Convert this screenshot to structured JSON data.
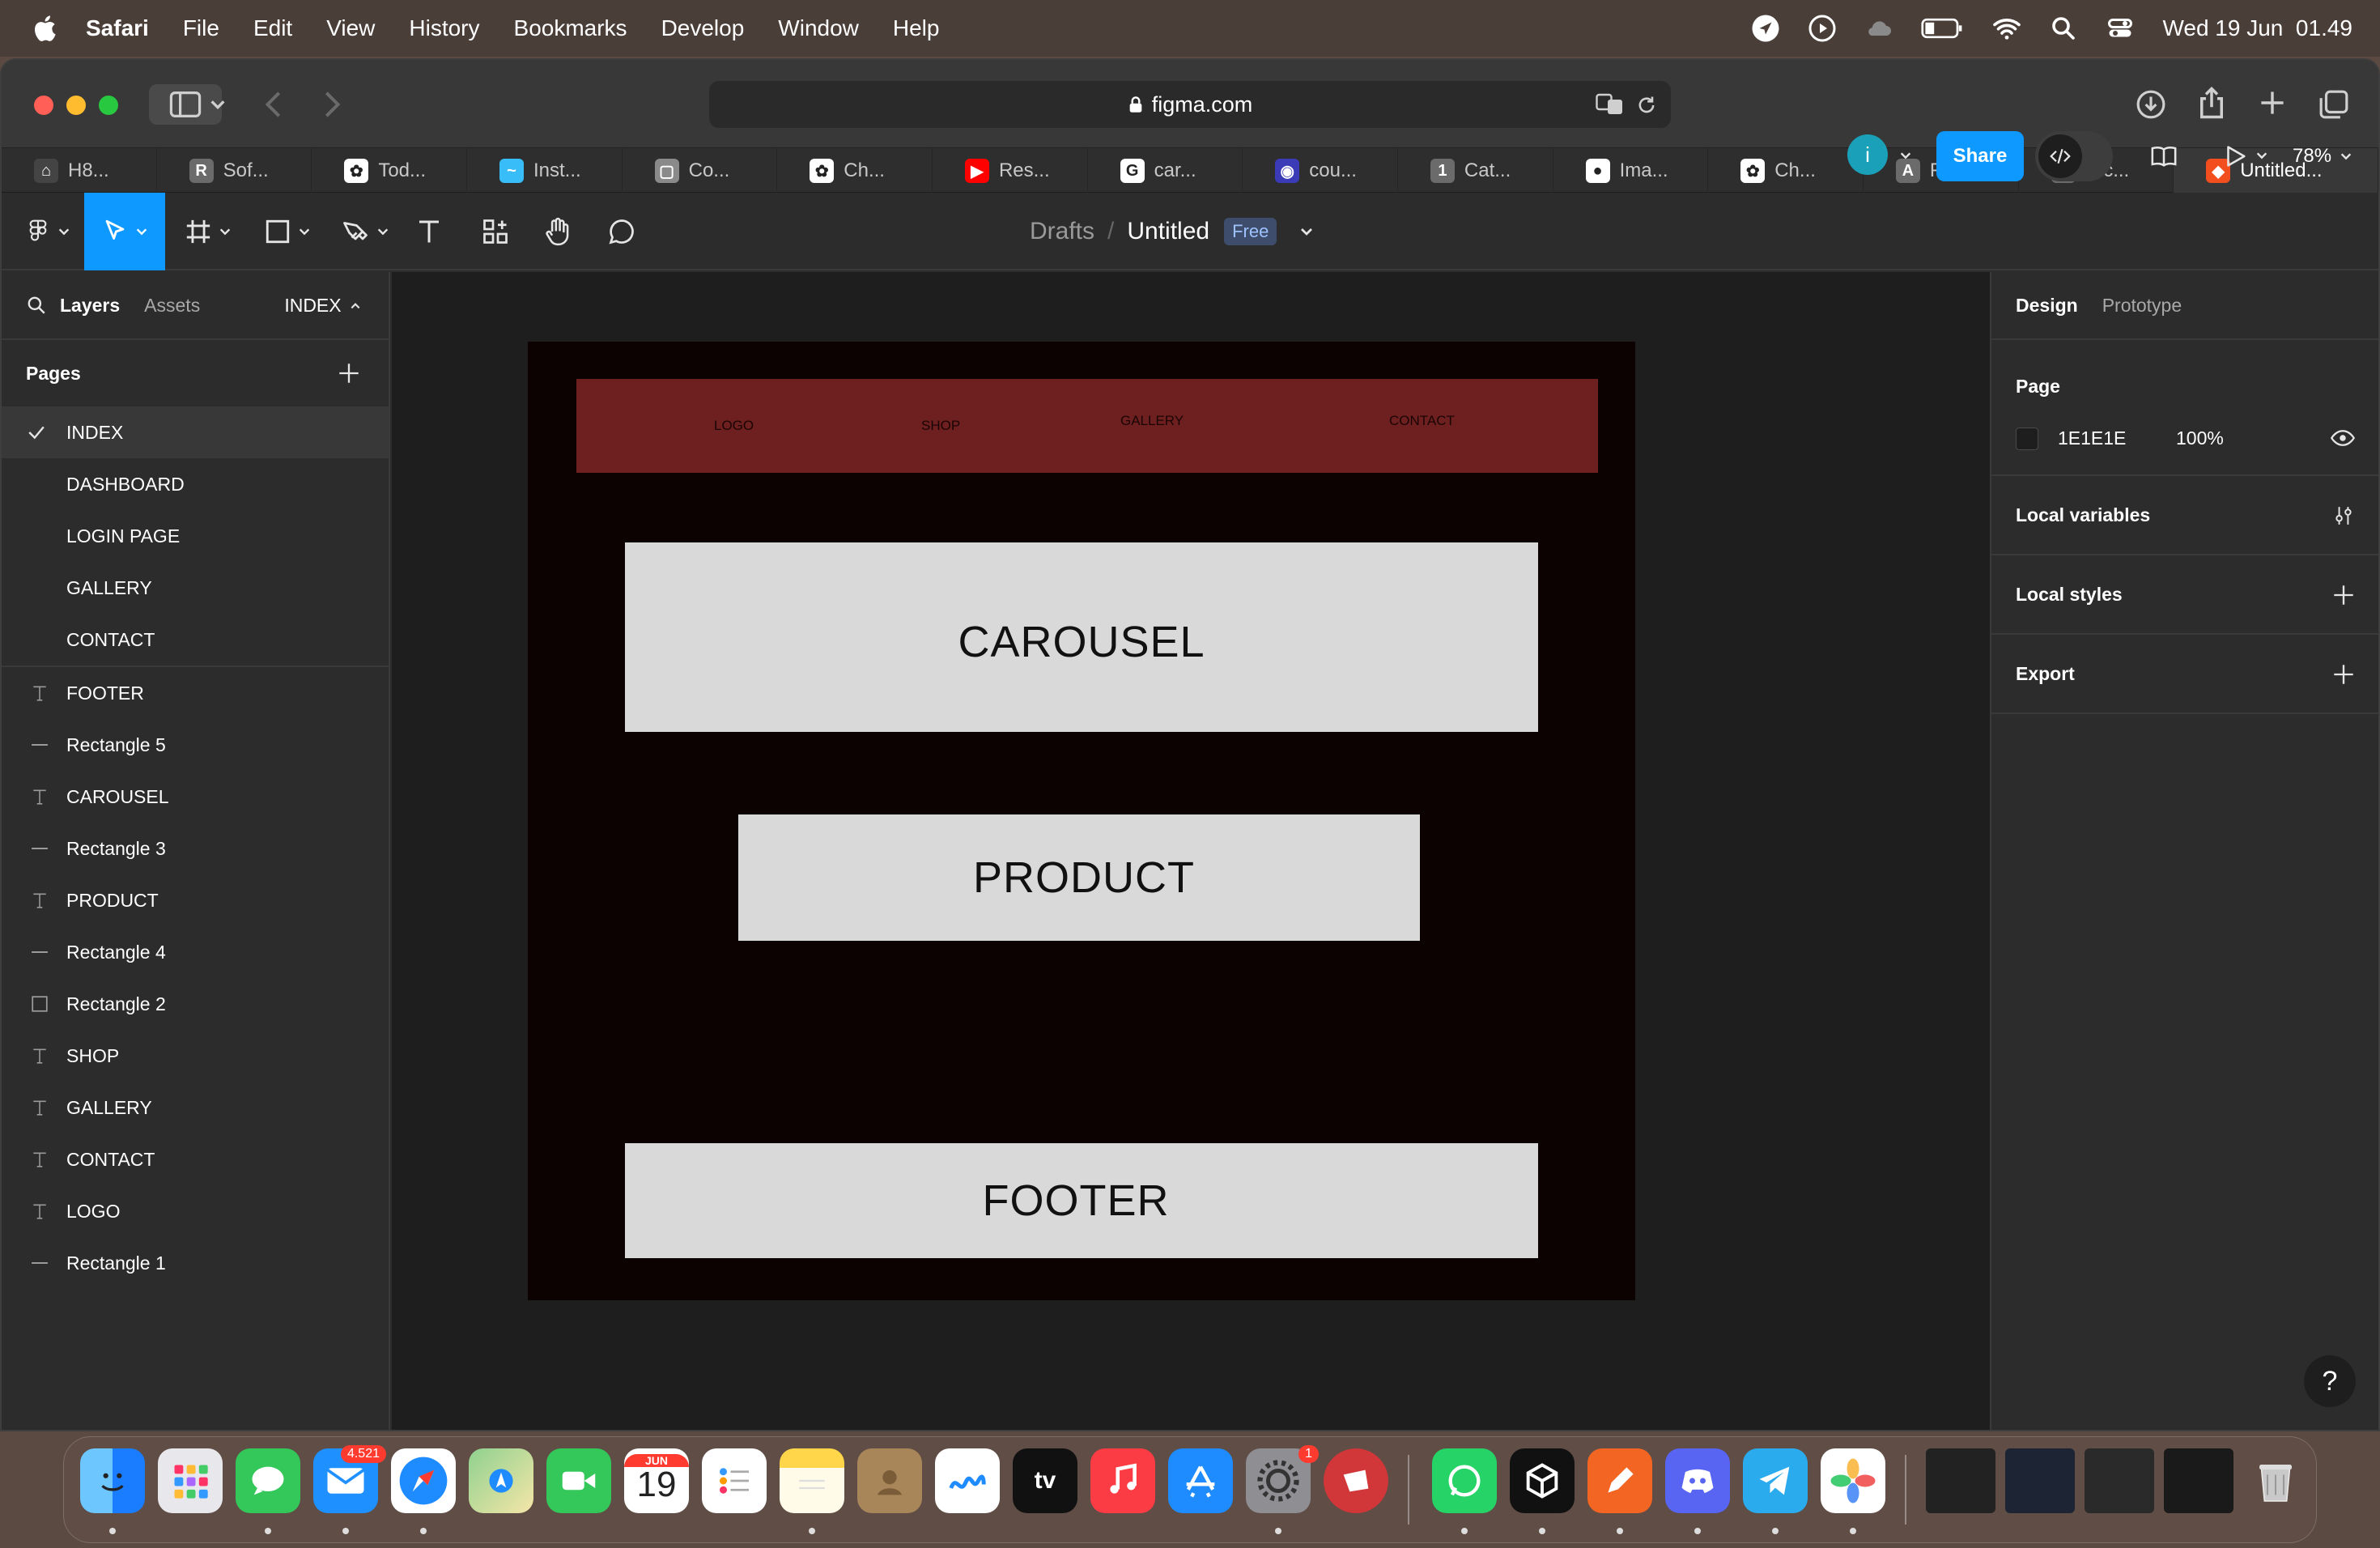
{
  "menubar": {
    "app": "Safari",
    "items": [
      "File",
      "Edit",
      "View",
      "History",
      "Bookmarks",
      "Develop",
      "Window",
      "Help"
    ],
    "datetime": "Wed 19 Jun  01.49"
  },
  "browser": {
    "url": "figma.com",
    "tabs": [
      {
        "label": "H8...",
        "color": "#444444",
        "glyph": "⌂"
      },
      {
        "label": "Sof...",
        "color": "#6b6b6b",
        "glyph": "R"
      },
      {
        "label": "Tod...",
        "color": "#ffffff",
        "glyph": "✿"
      },
      {
        "label": "Inst...",
        "color": "#38bdf8",
        "glyph": "~"
      },
      {
        "label": "Co...",
        "color": "#8a8a8a",
        "glyph": "▢"
      },
      {
        "label": "Ch...",
        "color": "#ffffff",
        "glyph": "✿"
      },
      {
        "label": "Res...",
        "color": "#ff0000",
        "glyph": "▶"
      },
      {
        "label": "car...",
        "color": "#ffffff",
        "glyph": "G"
      },
      {
        "label": "cou...",
        "color": "#3b3bb8",
        "glyph": "◉"
      },
      {
        "label": "Cat...",
        "color": "#6b6b6b",
        "glyph": "1"
      },
      {
        "label": "Ima...",
        "color": "#ffffff",
        "glyph": "●"
      },
      {
        "label": "Ch...",
        "color": "#ffffff",
        "glyph": "✿"
      },
      {
        "label": "Fre...",
        "color": "#6b6b6b",
        "glyph": "A"
      },
      {
        "label": "Nic...",
        "color": "#6b6b6b",
        "glyph": "B"
      },
      {
        "label": "Untitled...",
        "color": "#f24e1e",
        "glyph": "◆"
      }
    ]
  },
  "figma": {
    "breadcrumb_drafts": "Drafts",
    "file_name": "Untitled",
    "plan_badge": "Free",
    "avatar_initial": "i",
    "share_label": "Share",
    "zoom": "78%",
    "left_tabs": {
      "layers": "Layers",
      "assets": "Assets",
      "current_page": "INDEX"
    },
    "pages_title": "Pages",
    "pages": [
      "INDEX",
      "DASHBOARD",
      "LOGIN PAGE",
      "GALLERY",
      "CONTACT"
    ],
    "layers": [
      {
        "name": "FOOTER",
        "type": "text"
      },
      {
        "name": "Rectangle 5",
        "type": "line"
      },
      {
        "name": "CAROUSEL",
        "type": "text"
      },
      {
        "name": "Rectangle 3",
        "type": "line"
      },
      {
        "name": "PRODUCT",
        "type": "text"
      },
      {
        "name": "Rectangle 4",
        "type": "line"
      },
      {
        "name": "Rectangle 2",
        "type": "rect"
      },
      {
        "name": "SHOP",
        "type": "text"
      },
      {
        "name": "GALLERY",
        "type": "text"
      },
      {
        "name": "CONTACT",
        "type": "text"
      },
      {
        "name": "LOGO",
        "type": "text"
      },
      {
        "name": "Rectangle 1",
        "type": "line"
      }
    ],
    "design_tabs": {
      "design": "Design",
      "prototype": "Prototype"
    },
    "page_section": {
      "title": "Page",
      "color": "1E1E1E",
      "opacity": "100%"
    },
    "local_variables": "Local variables",
    "local_styles": "Local styles",
    "export": "Export",
    "help": "?"
  },
  "canvas": {
    "nav": {
      "logo": "LOGO",
      "shop": "SHOP",
      "gallery": "GALLERY",
      "contact": "CONTACT"
    },
    "carousel": "CAROUSEL",
    "product": "PRODUCT",
    "footer": "FOOTER",
    "nav_color": "#6e1f1f",
    "frame_color": "#0c0202"
  },
  "dock": {
    "mail_badge": "4.521",
    "calendar_month": "JUN",
    "calendar_day": "19",
    "settings_badge": "1",
    "tv_label": "tv"
  }
}
